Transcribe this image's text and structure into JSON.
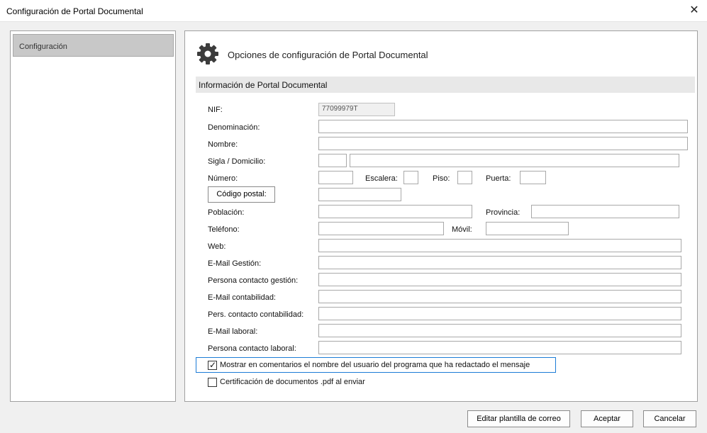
{
  "window": {
    "title": "Configuración de Portal Documental",
    "close_glyph": "✕"
  },
  "sidebar": {
    "items": [
      {
        "label": "Configuración"
      }
    ]
  },
  "panel": {
    "title": "Opciones de configuración de Portal Documental",
    "section": "Información de Portal Documental",
    "icon": "gear-icon"
  },
  "form": {
    "nif_label": "NIF:",
    "nif_value": "77099979T",
    "denominacion_label": "Denominación:",
    "nombre_label": "Nombre:",
    "sigla_label": "Sigla / Domicilio:",
    "numero_label": "Número:",
    "escalera_label": "Escalera:",
    "piso_label": "Piso:",
    "puerta_label": "Puerta:",
    "codigo_postal_button": "Código postal:",
    "poblacion_label": "Población:",
    "provincia_label": "Provincia:",
    "telefono_label": "Teléfono:",
    "movil_label": "Móvil:",
    "web_label": "Web:",
    "email_gestion_label": "E-Mail Gestión:",
    "persona_gestion_label": "Persona contacto gestión:",
    "email_contabilidad_label": "E-Mail contabilidad:",
    "persona_contabilidad_label": "Pers. contacto contabilidad:",
    "email_laboral_label": "E-Mail laboral:",
    "persona_laboral_label": "Persona contacto laboral:"
  },
  "checkboxes": {
    "mostrar_nombre": {
      "label": "Mostrar en comentarios el nombre del usuario del programa que ha redactado el mensaje",
      "checked": true,
      "glyph": "✓"
    },
    "certificacion_pdf": {
      "label": "Certificación de documentos .pdf al enviar",
      "checked": false
    }
  },
  "buttons": {
    "plantilla": "Editar plantilla de correo",
    "aceptar": "Aceptar",
    "cancelar": "Cancelar"
  }
}
